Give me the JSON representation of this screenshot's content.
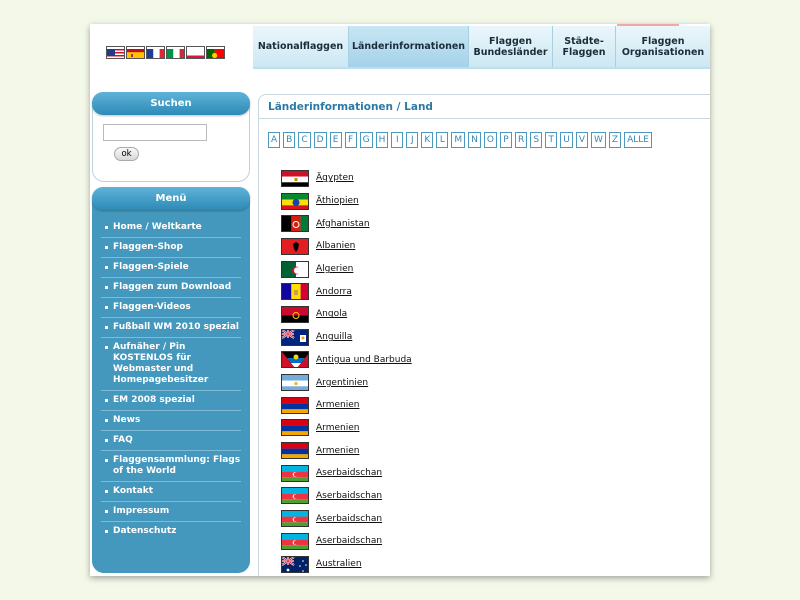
{
  "colors": {
    "page_background": "#f3f8e9",
    "sidebar_blue": "#4497bd",
    "heading_blue": "#2a7aa7",
    "tab_gradient": [
      "#eaf6fb",
      "#cde8f3"
    ]
  },
  "language_flags": [
    {
      "name": "us-flag-icon"
    },
    {
      "name": "spain-flag-icon"
    },
    {
      "name": "france-flag-icon"
    },
    {
      "name": "italy-flag-icon"
    },
    {
      "name": "poland-flag-icon"
    },
    {
      "name": "portugal-flag-icon"
    }
  ],
  "nav": {
    "tabs": [
      {
        "label": "Nationalflaggen",
        "active": false
      },
      {
        "label": "Länderinformationen",
        "active": true
      },
      {
        "label": "Flaggen\nBundesländer",
        "active": false
      },
      {
        "label": "Städte-\nFlaggen",
        "active": false
      },
      {
        "label": "Flaggen\nOrganisationen",
        "active": false
      }
    ]
  },
  "search": {
    "title": "Suchen",
    "input_value": "",
    "button_label": "ok"
  },
  "menu": {
    "title": "Menü",
    "items": [
      "Home / Weltkarte",
      "Flaggen-Shop",
      "Flaggen-Spiele",
      "Flaggen zum Download",
      "Flaggen-Videos",
      "Fußball WM 2010 spezial",
      "Aufnäher / Pin KOSTENLOS für Webmaster und Homepagebesitzer",
      "EM 2008 spezial",
      "News",
      "FAQ",
      "Flaggensammlung: Flags of the World",
      "Kontakt",
      "Impressum",
      "Datenschutz"
    ]
  },
  "main": {
    "heading": "Länderinformationen / Land",
    "letters": [
      "A",
      "B",
      "C",
      "D",
      "E",
      "F",
      "G",
      "H",
      "I",
      "J",
      "K",
      "L",
      "M",
      "N",
      "O",
      "P",
      "R",
      "S",
      "T",
      "U",
      "V",
      "W",
      "Z",
      "ALLE"
    ],
    "countries": [
      {
        "name": "Ägypten",
        "flag": "egypt"
      },
      {
        "name": "Äthiopien",
        "flag": "ethiopia"
      },
      {
        "name": "Afghanistan",
        "flag": "afghanistan"
      },
      {
        "name": "Albanien",
        "flag": "albania"
      },
      {
        "name": "Algerien",
        "flag": "algeria"
      },
      {
        "name": "Andorra",
        "flag": "andorra"
      },
      {
        "name": "Angola",
        "flag": "angola"
      },
      {
        "name": "Anguilla",
        "flag": "anguilla"
      },
      {
        "name": "Antigua und Barbuda",
        "flag": "antigua"
      },
      {
        "name": "Argentinien",
        "flag": "argentina"
      },
      {
        "name": "Armenien",
        "flag": "armenia"
      },
      {
        "name": "Armenien",
        "flag": "armenia"
      },
      {
        "name": "Armenien",
        "flag": "armenia"
      },
      {
        "name": "Aserbaidschan",
        "flag": "azerbaijan"
      },
      {
        "name": "Aserbaidschan",
        "flag": "azerbaijan"
      },
      {
        "name": "Aserbaidschan",
        "flag": "azerbaijan"
      },
      {
        "name": "Aserbaidschan",
        "flag": "azerbaijan"
      },
      {
        "name": "Australien",
        "flag": "australia"
      }
    ]
  }
}
